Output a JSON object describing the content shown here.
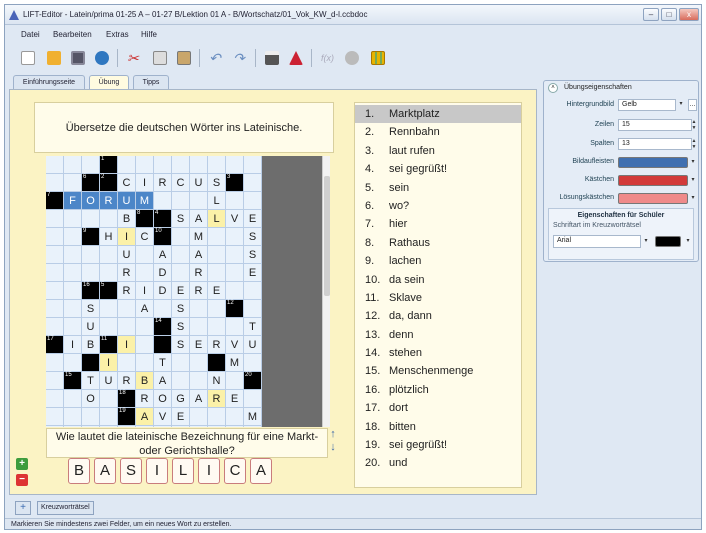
{
  "window": {
    "title": "LIFT-Editor - Latein/prima 01-25 A – 01-27 B/Lektion 01 A - B/Wortschatz/01_Vok_KW_d-l.ccbdoc"
  },
  "menu": [
    "Datei",
    "Bearbeiten",
    "Extras",
    "Hilfe"
  ],
  "toolbar": [
    "new-icon",
    "open-icon",
    "save-icon",
    "web-icon",
    "cut-icon",
    "copy-icon",
    "paste-icon",
    "undo-icon",
    "redo-icon",
    "print-icon",
    "preview-icon",
    "formula-icon",
    "tool-icon",
    "crossword-icon"
  ],
  "tabs": [
    "Einführungsseite",
    "Übung",
    "Tipps"
  ],
  "exercise": {
    "instruction": "Übersetze die deutschen Wörter ins Lateinische.",
    "clue": "Wie lautet die lateinische Bezeichnung für eine Markt- oder Gerichtshalle?",
    "answer_letters": [
      "B",
      "A",
      "S",
      "I",
      "L",
      "I",
      "C",
      "A"
    ]
  },
  "grid_rows": [
    "...1............",
    "..##CIRCUS#.....",
    "#FORUM...L..#...",
    "....B##SALVE....",
    "..#HIC#.M..S....",
    "....U.A.A..S....",
    "....R.D.R..E....",
    "..##RIDERE......",
    "..S..A.S..#.....",
    "..U...#S...T....",
    "#IB#I.#SERVUS...",
    "..#I..T..#M.....",
    ".#TURBA..N.#....",
    "..O.#ROGARE.....",
    "....#AVE...MT...",
    "................"
  ],
  "grid_numbers": {
    "0,3": "1",
    "1,2": "6",
    "1,3": "2",
    "1,10": "3",
    "2,0": "7",
    "2,12": "5",
    "3,5": "8",
    "3,6": "4",
    "4,2": "9",
    "4,6": "10",
    "7,2": "16",
    "7,3": "5",
    "8,10": "12",
    "9,6": "14",
    "10,0": "17",
    "10,3": "11",
    "12,1": "15",
    "12,11": "20",
    "13,4": "18",
    "14,4": "19"
  },
  "grid_yellow": [
    "1,10",
    "3,9",
    "4,4",
    "10,4",
    "11,3",
    "12,5",
    "13,9",
    "14,5"
  ],
  "grid_highlight": [
    "2,1",
    "2,2",
    "2,3",
    "2,4",
    "2,5"
  ],
  "wordlist": [
    {
      "n": "1.",
      "w": "Marktplatz"
    },
    {
      "n": "2.",
      "w": "Rennbahn"
    },
    {
      "n": "3.",
      "w": "laut rufen"
    },
    {
      "n": "4.",
      "w": "sei gegrüßt!"
    },
    {
      "n": "5.",
      "w": "sein"
    },
    {
      "n": "6.",
      "w": "wo?"
    },
    {
      "n": "7.",
      "w": "hier"
    },
    {
      "n": "8.",
      "w": "Rathaus"
    },
    {
      "n": "9.",
      "w": "lachen"
    },
    {
      "n": "10.",
      "w": "da sein"
    },
    {
      "n": "11.",
      "w": "Sklave"
    },
    {
      "n": "12.",
      "w": "da, dann"
    },
    {
      "n": "13.",
      "w": "denn"
    },
    {
      "n": "14.",
      "w": "stehen"
    },
    {
      "n": "15.",
      "w": "Menschenmenge"
    },
    {
      "n": "16.",
      "w": "plötzlich"
    },
    {
      "n": "17.",
      "w": "dort"
    },
    {
      "n": "18.",
      "w": "bitten"
    },
    {
      "n": "19.",
      "w": "sei gegrüßt!"
    },
    {
      "n": "20.",
      "w": "und"
    }
  ],
  "panel": {
    "title": "Übungseigenschaften",
    "bg_label": "Hintergrundbild",
    "bg_value": "Gelb",
    "rows_label": "Zeilen",
    "rows_value": "15",
    "cols_label": "Spalten",
    "cols_value": "13",
    "image_label": "Bildaufleisten",
    "image_color": "#3f6fb0",
    "box_label": "Kästchen",
    "box_color": "#d23a3a",
    "solution_label": "Lösungskästchen",
    "solution_color": "#ef8a8a",
    "student_title": "Eigenschaften für Schüler",
    "font_label": "Schriftart im Kreuzworträtsel",
    "font_value": "Arial",
    "font_color": "#000000"
  },
  "bottom_tab": "Kreuzworträtsel",
  "status": "Markieren Sie mindestens zwei Felder, um ein neues Wort zu erstellen."
}
